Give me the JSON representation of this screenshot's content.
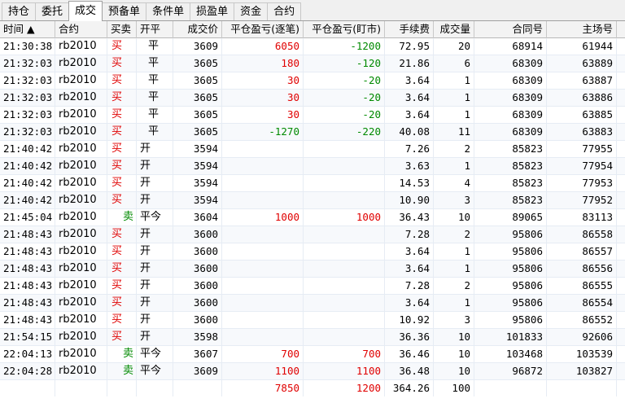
{
  "tabs": [
    {
      "label": "持仓",
      "active": false
    },
    {
      "label": "委托",
      "active": false
    },
    {
      "label": "成交",
      "active": true
    },
    {
      "label": "预备单",
      "active": false
    },
    {
      "label": "条件单",
      "active": false
    },
    {
      "label": "损盈单",
      "active": false
    },
    {
      "label": "资金",
      "active": false
    },
    {
      "label": "合约",
      "active": false
    }
  ],
  "columns": {
    "time": "时间 ▲",
    "contract": "合约",
    "side": "买卖",
    "open_close": "开平",
    "price": "成交价",
    "pnl_close": "平仓盈亏(逐笔)",
    "pnl_mtm": "平仓盈亏(盯市)",
    "fee": "手续费",
    "qty": "成交量",
    "contract_no": "合同号",
    "exchange_no": "主场号"
  },
  "colors": {
    "buy": "#e00000",
    "sell": "#008a00",
    "positive": "#e00000",
    "negative": "#008a00"
  },
  "trades": [
    {
      "time": "21:30:38",
      "contract": "rb2010",
      "side": "买",
      "side_type": "buy",
      "oc": "平",
      "oc_type": "close",
      "price": "3609",
      "pnl_close": "6050",
      "pnl_close_sign": "pos",
      "pnl_mtm": "-1200",
      "pnl_mtm_sign": "neg",
      "fee": "72.95",
      "qty": "20",
      "contract_no": "68914",
      "exchange_no": "61944"
    },
    {
      "time": "21:32:03",
      "contract": "rb2010",
      "side": "买",
      "side_type": "buy",
      "oc": "平",
      "oc_type": "close",
      "price": "3605",
      "pnl_close": "180",
      "pnl_close_sign": "pos",
      "pnl_mtm": "-120",
      "pnl_mtm_sign": "neg",
      "fee": "21.86",
      "qty": "6",
      "contract_no": "68309",
      "exchange_no": "63889"
    },
    {
      "time": "21:32:03",
      "contract": "rb2010",
      "side": "买",
      "side_type": "buy",
      "oc": "平",
      "oc_type": "close",
      "price": "3605",
      "pnl_close": "30",
      "pnl_close_sign": "pos",
      "pnl_mtm": "-20",
      "pnl_mtm_sign": "neg",
      "fee": "3.64",
      "qty": "1",
      "contract_no": "68309",
      "exchange_no": "63887"
    },
    {
      "time": "21:32:03",
      "contract": "rb2010",
      "side": "买",
      "side_type": "buy",
      "oc": "平",
      "oc_type": "close",
      "price": "3605",
      "pnl_close": "30",
      "pnl_close_sign": "pos",
      "pnl_mtm": "-20",
      "pnl_mtm_sign": "neg",
      "fee": "3.64",
      "qty": "1",
      "contract_no": "68309",
      "exchange_no": "63886"
    },
    {
      "time": "21:32:03",
      "contract": "rb2010",
      "side": "买",
      "side_type": "buy",
      "oc": "平",
      "oc_type": "close",
      "price": "3605",
      "pnl_close": "30",
      "pnl_close_sign": "pos",
      "pnl_mtm": "-20",
      "pnl_mtm_sign": "neg",
      "fee": "3.64",
      "qty": "1",
      "contract_no": "68309",
      "exchange_no": "63885"
    },
    {
      "time": "21:32:03",
      "contract": "rb2010",
      "side": "买",
      "side_type": "buy",
      "oc": "平",
      "oc_type": "close",
      "price": "3605",
      "pnl_close": "-1270",
      "pnl_close_sign": "neg",
      "pnl_mtm": "-220",
      "pnl_mtm_sign": "neg",
      "fee": "40.08",
      "qty": "11",
      "contract_no": "68309",
      "exchange_no": "63883"
    },
    {
      "time": "21:40:42",
      "contract": "rb2010",
      "side": "买",
      "side_type": "buy",
      "oc": "开",
      "oc_type": "open",
      "price": "3594",
      "pnl_close": "",
      "pnl_close_sign": "",
      "pnl_mtm": "",
      "pnl_mtm_sign": "",
      "fee": "7.26",
      "qty": "2",
      "contract_no": "85823",
      "exchange_no": "77955"
    },
    {
      "time": "21:40:42",
      "contract": "rb2010",
      "side": "买",
      "side_type": "buy",
      "oc": "开",
      "oc_type": "open",
      "price": "3594",
      "pnl_close": "",
      "pnl_close_sign": "",
      "pnl_mtm": "",
      "pnl_mtm_sign": "",
      "fee": "3.63",
      "qty": "1",
      "contract_no": "85823",
      "exchange_no": "77954"
    },
    {
      "time": "21:40:42",
      "contract": "rb2010",
      "side": "买",
      "side_type": "buy",
      "oc": "开",
      "oc_type": "open",
      "price": "3594",
      "pnl_close": "",
      "pnl_close_sign": "",
      "pnl_mtm": "",
      "pnl_mtm_sign": "",
      "fee": "14.53",
      "qty": "4",
      "contract_no": "85823",
      "exchange_no": "77953"
    },
    {
      "time": "21:40:42",
      "contract": "rb2010",
      "side": "买",
      "side_type": "buy",
      "oc": "开",
      "oc_type": "open",
      "price": "3594",
      "pnl_close": "",
      "pnl_close_sign": "",
      "pnl_mtm": "",
      "pnl_mtm_sign": "",
      "fee": "10.90",
      "qty": "3",
      "contract_no": "85823",
      "exchange_no": "77952"
    },
    {
      "time": "21:45:04",
      "contract": "rb2010",
      "side": "卖",
      "side_type": "sell",
      "oc": "平今",
      "oc_type": "open",
      "price": "3604",
      "pnl_close": "1000",
      "pnl_close_sign": "pos",
      "pnl_mtm": "1000",
      "pnl_mtm_sign": "pos",
      "fee": "36.43",
      "qty": "10",
      "contract_no": "89065",
      "exchange_no": "83113"
    },
    {
      "time": "21:48:43",
      "contract": "rb2010",
      "side": "买",
      "side_type": "buy",
      "oc": "开",
      "oc_type": "open",
      "price": "3600",
      "pnl_close": "",
      "pnl_close_sign": "",
      "pnl_mtm": "",
      "pnl_mtm_sign": "",
      "fee": "7.28",
      "qty": "2",
      "contract_no": "95806",
      "exchange_no": "86558"
    },
    {
      "time": "21:48:43",
      "contract": "rb2010",
      "side": "买",
      "side_type": "buy",
      "oc": "开",
      "oc_type": "open",
      "price": "3600",
      "pnl_close": "",
      "pnl_close_sign": "",
      "pnl_mtm": "",
      "pnl_mtm_sign": "",
      "fee": "3.64",
      "qty": "1",
      "contract_no": "95806",
      "exchange_no": "86557"
    },
    {
      "time": "21:48:43",
      "contract": "rb2010",
      "side": "买",
      "side_type": "buy",
      "oc": "开",
      "oc_type": "open",
      "price": "3600",
      "pnl_close": "",
      "pnl_close_sign": "",
      "pnl_mtm": "",
      "pnl_mtm_sign": "",
      "fee": "3.64",
      "qty": "1",
      "contract_no": "95806",
      "exchange_no": "86556"
    },
    {
      "time": "21:48:43",
      "contract": "rb2010",
      "side": "买",
      "side_type": "buy",
      "oc": "开",
      "oc_type": "open",
      "price": "3600",
      "pnl_close": "",
      "pnl_close_sign": "",
      "pnl_mtm": "",
      "pnl_mtm_sign": "",
      "fee": "7.28",
      "qty": "2",
      "contract_no": "95806",
      "exchange_no": "86555"
    },
    {
      "time": "21:48:43",
      "contract": "rb2010",
      "side": "买",
      "side_type": "buy",
      "oc": "开",
      "oc_type": "open",
      "price": "3600",
      "pnl_close": "",
      "pnl_close_sign": "",
      "pnl_mtm": "",
      "pnl_mtm_sign": "",
      "fee": "3.64",
      "qty": "1",
      "contract_no": "95806",
      "exchange_no": "86554"
    },
    {
      "time": "21:48:43",
      "contract": "rb2010",
      "side": "买",
      "side_type": "buy",
      "oc": "开",
      "oc_type": "open",
      "price": "3600",
      "pnl_close": "",
      "pnl_close_sign": "",
      "pnl_mtm": "",
      "pnl_mtm_sign": "",
      "fee": "10.92",
      "qty": "3",
      "contract_no": "95806",
      "exchange_no": "86552"
    },
    {
      "time": "21:54:15",
      "contract": "rb2010",
      "side": "买",
      "side_type": "buy",
      "oc": "开",
      "oc_type": "open",
      "price": "3598",
      "pnl_close": "",
      "pnl_close_sign": "",
      "pnl_mtm": "",
      "pnl_mtm_sign": "",
      "fee": "36.36",
      "qty": "10",
      "contract_no": "101833",
      "exchange_no": "92606"
    },
    {
      "time": "22:04:13",
      "contract": "rb2010",
      "side": "卖",
      "side_type": "sell",
      "oc": "平今",
      "oc_type": "open",
      "price": "3607",
      "pnl_close": "700",
      "pnl_close_sign": "pos",
      "pnl_mtm": "700",
      "pnl_mtm_sign": "pos",
      "fee": "36.46",
      "qty": "10",
      "contract_no": "103468",
      "exchange_no": "103539"
    },
    {
      "time": "22:04:28",
      "contract": "rb2010",
      "side": "卖",
      "side_type": "sell",
      "oc": "平今",
      "oc_type": "open",
      "price": "3609",
      "pnl_close": "1100",
      "pnl_close_sign": "pos",
      "pnl_mtm": "1100",
      "pnl_mtm_sign": "pos",
      "fee": "36.48",
      "qty": "10",
      "contract_no": "96872",
      "exchange_no": "103827"
    }
  ],
  "totals": {
    "pnl_close": "7850",
    "pnl_mtm": "1200",
    "fee": "364.26",
    "qty": "100"
  }
}
